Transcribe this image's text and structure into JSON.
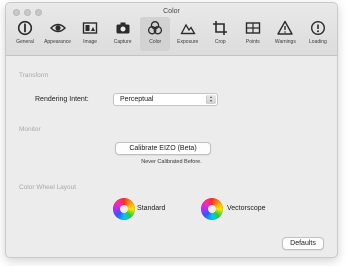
{
  "window": {
    "title": "Color"
  },
  "toolbar": {
    "items": [
      {
        "label": "General",
        "icon": "general-icon"
      },
      {
        "label": "Appearance",
        "icon": "eye-icon"
      },
      {
        "label": "Image",
        "icon": "image-icon"
      },
      {
        "label": "Capture",
        "icon": "camera-icon"
      },
      {
        "label": "Color",
        "icon": "color-icon",
        "active": true
      },
      {
        "label": "Exposure",
        "icon": "exposure-icon"
      },
      {
        "label": "Crop",
        "icon": "crop-icon"
      },
      {
        "label": "Points",
        "icon": "points-icon"
      },
      {
        "label": "Warnings",
        "icon": "warning-icon"
      },
      {
        "label": "Loading",
        "icon": "loading-icon"
      }
    ]
  },
  "transform": {
    "section_label": "Transform",
    "rendering_intent_label": "Rendering Intent:",
    "rendering_intent_value": "Perceptual"
  },
  "monitor": {
    "section_label": "Monitor",
    "calibrate_button": "Calibrate EIZO (Beta)",
    "status": "Never Calibrated Before."
  },
  "color_wheel": {
    "section_label": "Color Wheel Layout",
    "options": [
      "Standard",
      "Vectorscope"
    ]
  },
  "footer": {
    "defaults_button": "Defaults"
  },
  "colors": {
    "window_bg": "#ececec",
    "active_tab": "#d2d2d2"
  }
}
